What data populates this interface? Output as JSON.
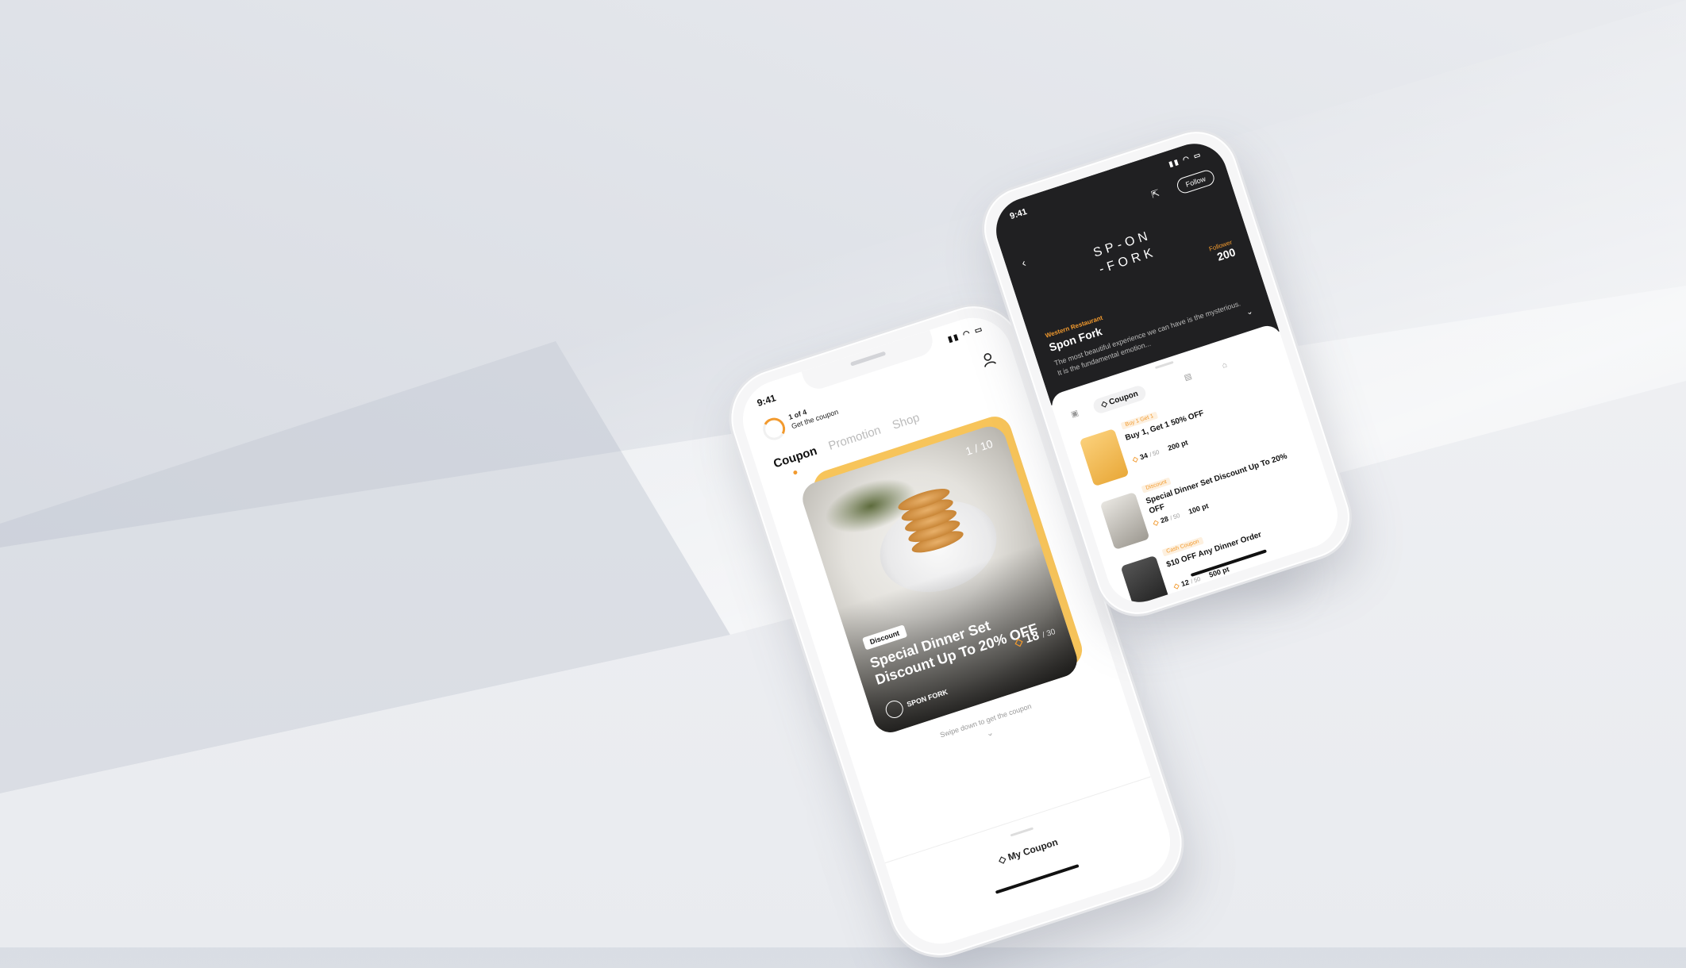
{
  "phone_left": {
    "status_time": "9:41",
    "progress": {
      "line1": "1 of 4",
      "line2": "Get the coupon"
    },
    "tabs": [
      "Coupon",
      "Promotion",
      "Shop"
    ],
    "card": {
      "counter": "1 / 10",
      "badge": "Discount",
      "title": "Special Dinner Set Discount Up To 20% OFF",
      "count": "18",
      "count_total": "/ 30",
      "brand": "SPON FORK"
    },
    "swipe_hint": "Swipe down to get the coupon",
    "my_coupon": "My Coupon"
  },
  "phone_right": {
    "status_time": "9:41",
    "follow": "Follow",
    "logo_line1": "SP-ON",
    "logo_line2": "-FORK",
    "follower_label": "Follower",
    "follower_count": "200",
    "category": "Western Restaurant",
    "shop_name": "Spon Fork",
    "description": "The most beautiful experience we can have is the mysterious. It is the fundamental emotion...",
    "tab_active": "Coupon",
    "items": [
      {
        "tag": "Buy 1 Get 1",
        "name": "Buy 1, Get 1 50% OFF",
        "count": "34",
        "total": "/ 50",
        "points": "200 pt",
        "color": "#f7c45a"
      },
      {
        "tag": "Discount",
        "name": "Special Dinner Set Discount Up To 20% OFF",
        "count": "28",
        "total": "/ 50",
        "points": "100 pt",
        "color": "#c9c4bb"
      },
      {
        "tag": "Cash Coupon",
        "name": "$10 OFF Any Dinner Order",
        "count": "12",
        "total": "/ 50",
        "points": "500 pt",
        "color": "#3a3a3a"
      }
    ]
  },
  "accent_color": "#f29a2e"
}
